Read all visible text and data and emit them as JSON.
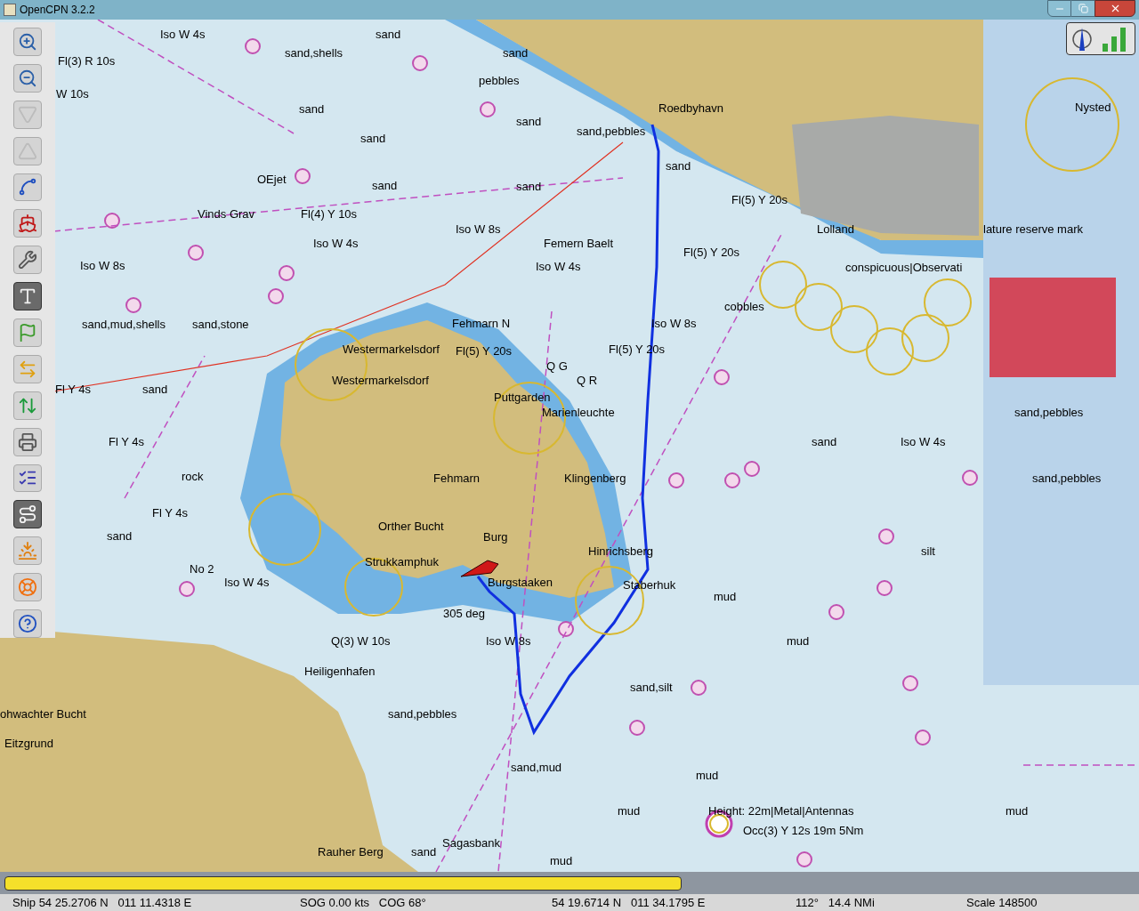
{
  "window": {
    "title": "OpenCPN 3.2.2"
  },
  "toolbar": [
    {
      "kind": "zoom-in",
      "active": false,
      "disabled": false
    },
    {
      "kind": "zoom-out",
      "active": false,
      "disabled": false
    },
    {
      "kind": "scale-down",
      "active": false,
      "disabled": true
    },
    {
      "kind": "scale-up",
      "active": false,
      "disabled": true
    },
    {
      "kind": "route",
      "active": false,
      "disabled": false
    },
    {
      "kind": "ship",
      "active": false,
      "disabled": false
    },
    {
      "kind": "settings",
      "active": false,
      "disabled": false
    },
    {
      "kind": "text",
      "active": true,
      "disabled": false
    },
    {
      "kind": "marks",
      "active": false,
      "disabled": false
    },
    {
      "kind": "tides",
      "active": false,
      "disabled": false
    },
    {
      "kind": "currents",
      "active": false,
      "disabled": false
    },
    {
      "kind": "print",
      "active": false,
      "disabled": false
    },
    {
      "kind": "route-manager",
      "active": false,
      "disabled": false
    },
    {
      "kind": "track",
      "active": true,
      "disabled": false
    },
    {
      "kind": "colour",
      "active": false,
      "disabled": false
    },
    {
      "kind": "mob",
      "active": false,
      "disabled": false
    },
    {
      "kind": "help",
      "active": false,
      "disabled": false
    }
  ],
  "map_labels": [
    "Iso W 4s",
    "sand",
    "sand,shells",
    "sand",
    "Fl(3) R 10s",
    "pebbles",
    "W 10s",
    "sand",
    "Roedbyhavn",
    "Nysted",
    "sand",
    "sand,pebbles",
    "sand",
    "sand",
    "OEjet",
    "sand",
    "sand",
    "Fl(5) Y 20s",
    "Vinds Grav",
    "Fl(4) Y 10s",
    "Iso W 8s",
    "Lolland",
    "lature reserve mark",
    "Iso W 4s",
    "Femern Baelt",
    "Fl(5) Y 20s",
    "Iso W 8s",
    "Iso W 4s",
    "conspicuous|Observati",
    "cobbles",
    "sand,mud,shells",
    "sand,stone",
    "Fehmarn N",
    "Iso W 8s",
    "Westermarkelsdorf",
    "Fl(5) Y 20s",
    "Fl(5) Y 20s",
    "Q G",
    "Westermarkelsdorf",
    "Q R",
    "Fl Y 4s",
    "sand",
    "Puttgarden",
    "Marienleuchte",
    "sand,pebbles",
    "Fl Y 4s",
    "sand",
    "Iso W 4s",
    "rock",
    "Fehmarn",
    "Klingenberg",
    "sand,pebbles",
    "Fl Y 4s",
    "Orther Bucht",
    "sand",
    "Burg",
    "Hinrichsberg",
    "silt",
    "Strukkamphuk",
    "No 2",
    "Iso W 4s",
    "Burgstaaken",
    "Staberhuk",
    "mud",
    "305 deg",
    "Q(3) W 10s",
    "Iso W 8s",
    "mud",
    "Heiligenhafen",
    "sand,silt",
    "ohwachter Bucht",
    "sand,pebbles",
    "Eitzgrund",
    "sand,mud",
    "mud",
    "mud",
    "Height: 22m|Metal|Antennas",
    "mud",
    "Occ(3) Y 12s 19m 5Nm",
    "Sagasbank",
    "Rauher Berg",
    "sand",
    "mud"
  ],
  "progress": {
    "level": 0.6
  },
  "status_bar": {
    "ship": "Ship 54 25.2706 N   011 11.4318 E",
    "speed": "SOG 0.00 kts   COG 68°",
    "cursor": "54 19.6714 N   011 34.1795 E",
    "bearing": "112°   14.4 NMi",
    "scale": "Scale 148500"
  }
}
